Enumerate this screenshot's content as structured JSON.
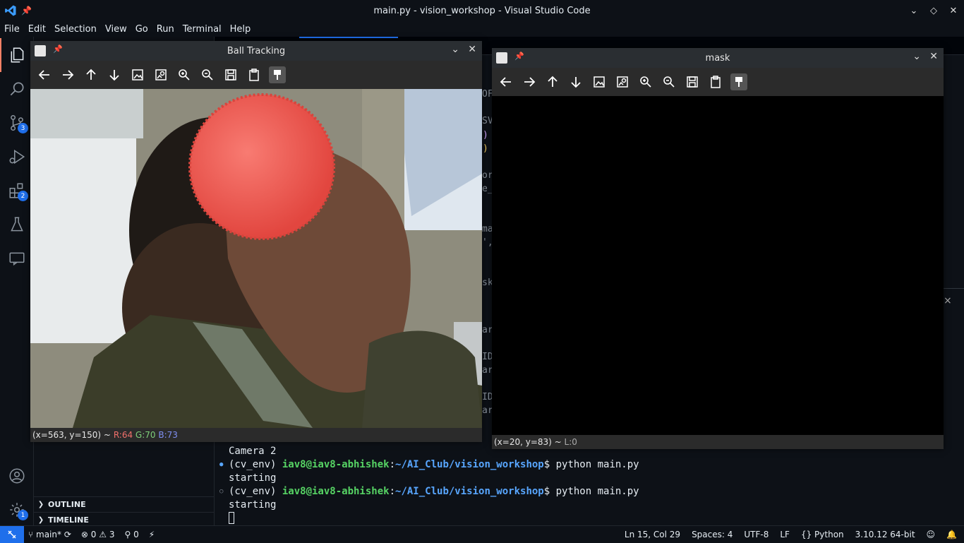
{
  "window": {
    "title": "main.py - vision_workshop - Visual Studio Code",
    "controls": [
      "chevron-down",
      "diamond",
      "close"
    ]
  },
  "menu": [
    "File",
    "Edit",
    "Selection",
    "View",
    "Go",
    "Run",
    "Terminal",
    "Help"
  ],
  "activity": {
    "source_control_badge": "3",
    "extensions_badge": "2",
    "accounts_badge": "1"
  },
  "sidebar": {
    "outline_label": "OUTLINE",
    "timeline_label": "TIMELINE"
  },
  "editor_fragments": [
    "OF",
    "SV",
    ")",
    ")",
    "or",
    "e_",
    "ma",
    "',",
    "sk",
    "ar",
    "ID",
    "ar",
    "ID",
    "ar"
  ],
  "panel_close": "×",
  "ball_window": {
    "title": "Ball Tracking",
    "status_coords": "(x=563, y=150) ~",
    "status_r": "R:64",
    "status_g": "G:70",
    "status_b": "B:73"
  },
  "mask_window": {
    "title": "mask",
    "status_coords": "(x=20, y=83) ~",
    "status_l": "L:0"
  },
  "toolbar_icons": [
    "arrow-left-icon",
    "arrow-right-icon",
    "arrow-up-icon",
    "arrow-down-icon",
    "image-icon",
    "image-search-icon",
    "zoom-in-icon",
    "zoom-out-icon",
    "save-icon",
    "clipboard-icon",
    "properties-icon"
  ],
  "terminal": {
    "lines": [
      {
        "type": "text",
        "text": "Camera 2"
      },
      {
        "type": "prompt",
        "dot": "●",
        "env": "(cv_env) ",
        "user": "iav8@iav8-abhishek",
        "path": "~/AI_Club/vision_workshop",
        "cmd": "$ python main.py"
      },
      {
        "type": "text",
        "text": "starting"
      },
      {
        "type": "prompt",
        "dot": "○",
        "env": "(cv_env) ",
        "user": "iav8@iav8-abhishek",
        "path": "~/AI_Club/vision_workshop",
        "cmd": "$ python main.py"
      },
      {
        "type": "text",
        "text": "starting"
      }
    ]
  },
  "status": {
    "branch": "main*",
    "errors": "0",
    "warnings": "3",
    "ports": "0",
    "position": "Ln 15, Col 29",
    "spaces": "Spaces: 4",
    "encoding": "UTF-8",
    "eol": "LF",
    "language": "Python",
    "interpreter": "3.10.12 64-bit"
  },
  "colors": {
    "accent": "#1f6feb",
    "ball": "#f25a55",
    "status_r": "#f2706b",
    "status_g": "#7fd17a",
    "status_b": "#7f8ff2"
  }
}
